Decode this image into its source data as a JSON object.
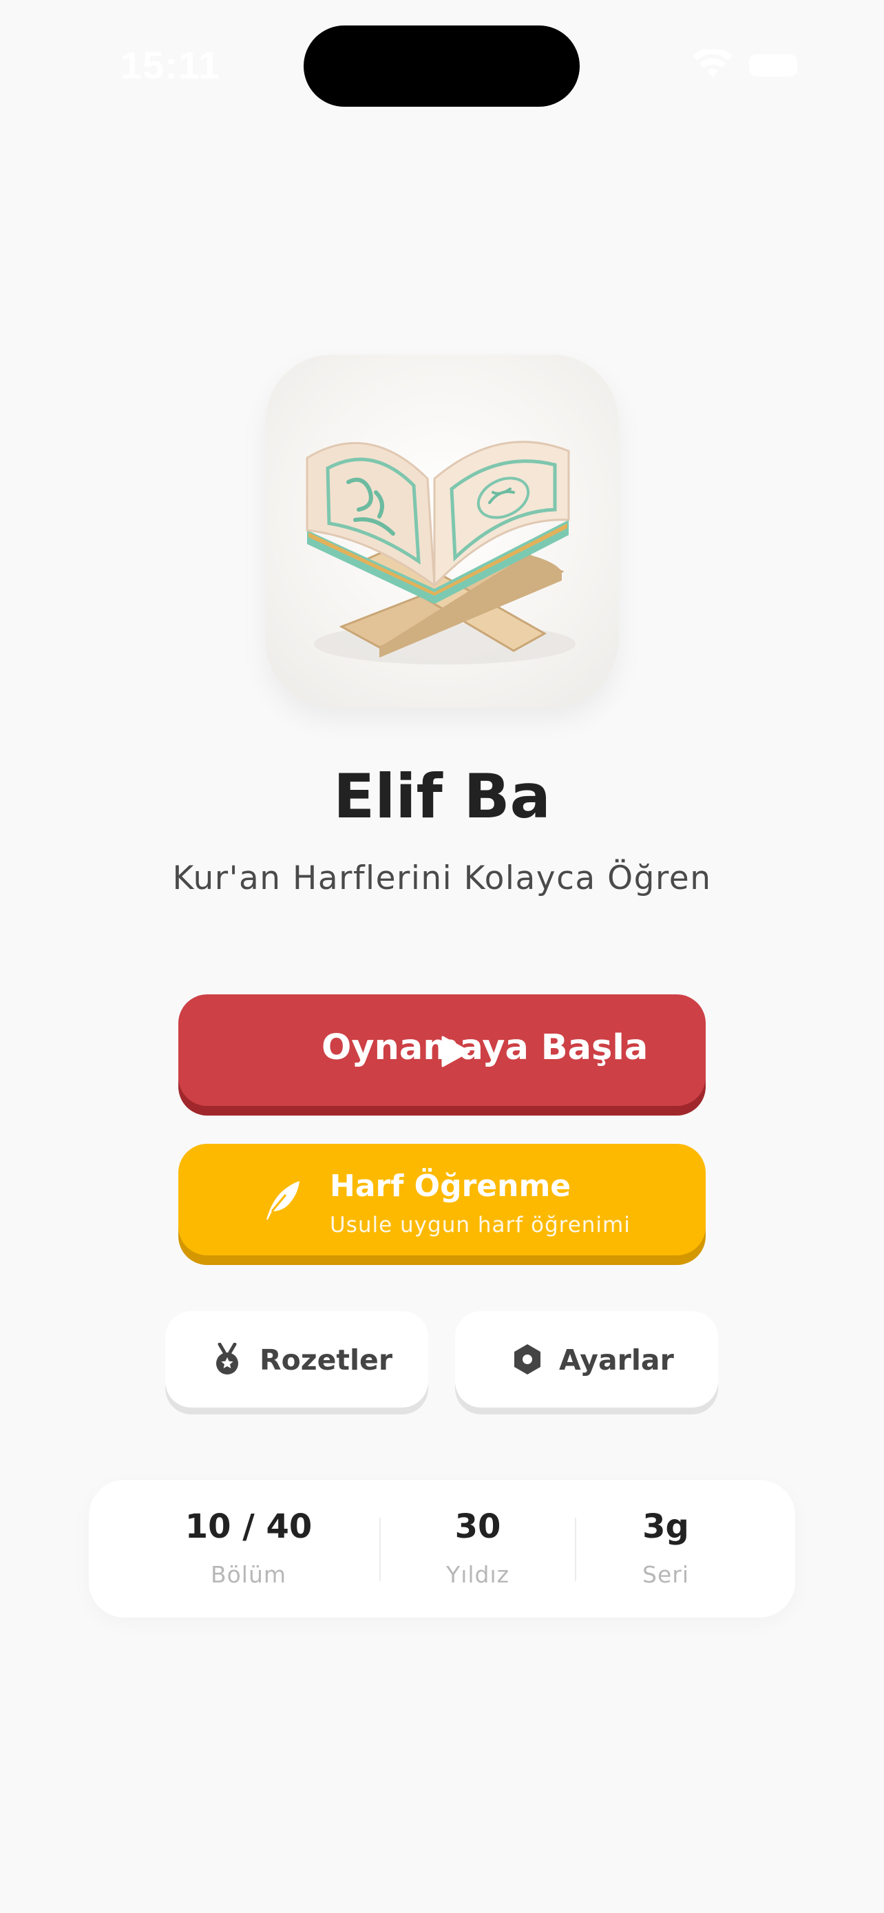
{
  "status_bar": {
    "time": "15:11"
  },
  "app": {
    "title": "Elif Ba",
    "subtitle": "Kur'an Harflerini Kolayca Öğren"
  },
  "buttons": {
    "play_label": "Oynamaya Başla",
    "letter_label": "Harf Öğrenme",
    "letter_sublabel": "Usule uygun harf öğrenimi",
    "badges_label": "Rozetler",
    "settings_label": "Ayarlar"
  },
  "stats": [
    {
      "value": "10 / 40",
      "caption": "Bölüm"
    },
    {
      "value": "30",
      "caption": "Yıldız"
    },
    {
      "value": "3g",
      "caption": "Seri"
    }
  ],
  "colors": {
    "play_button": "#cd4045",
    "letter_button": "#fdb900",
    "background": "#f9f9f9"
  },
  "icons": {
    "play": "play-icon",
    "letter": "feather-icon",
    "badges": "medal-icon",
    "settings": "hexagon-icon"
  }
}
